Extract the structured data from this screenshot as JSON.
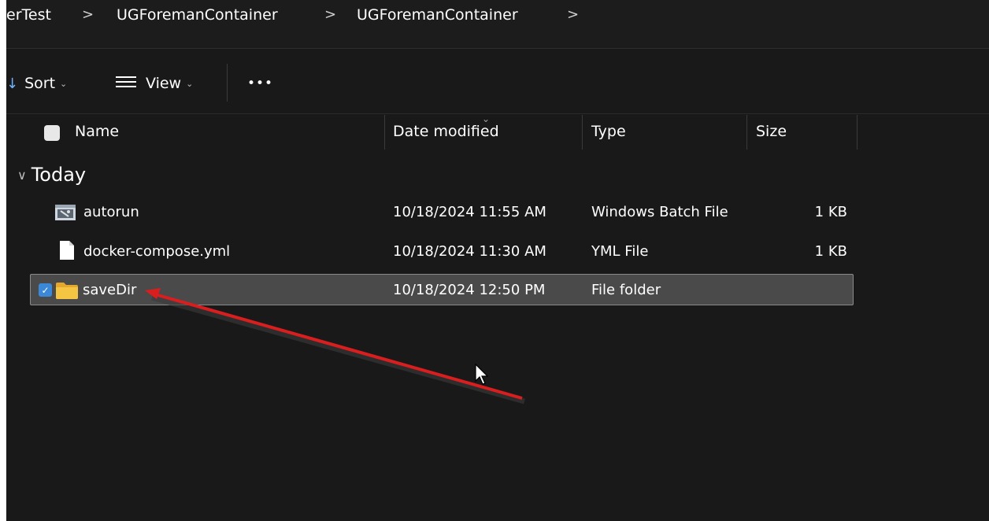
{
  "breadcrumb": {
    "items": [
      "erTest",
      "UGForemanContainer",
      "UGForemanContainer"
    ],
    "separator": ">"
  },
  "toolbar": {
    "sort_label": "Sort",
    "view_label": "View",
    "more_label": "•••"
  },
  "columns": {
    "name": "Name",
    "date": "Date modified",
    "type": "Type",
    "size": "Size"
  },
  "group": {
    "label": "Today"
  },
  "files": [
    {
      "name": "autorun",
      "date": "10/18/2024 11:55 AM",
      "type": "Windows Batch File",
      "size": "1 KB",
      "icon": "batch-file-icon",
      "selected": false
    },
    {
      "name": "docker-compose.yml",
      "date": "10/18/2024 11:30 AM",
      "type": "YML File",
      "size": "1 KB",
      "icon": "document-icon",
      "selected": false
    },
    {
      "name": "saveDir",
      "date": "10/18/2024 12:50 PM",
      "type": "File folder",
      "size": "",
      "icon": "folder-icon",
      "selected": true
    }
  ],
  "colors": {
    "background": "#191919",
    "selection": "#4a4a4a",
    "checkbox_accent": "#3c88d8",
    "folder": "#f4c542",
    "annotation_arrow": "#d81e1e"
  }
}
